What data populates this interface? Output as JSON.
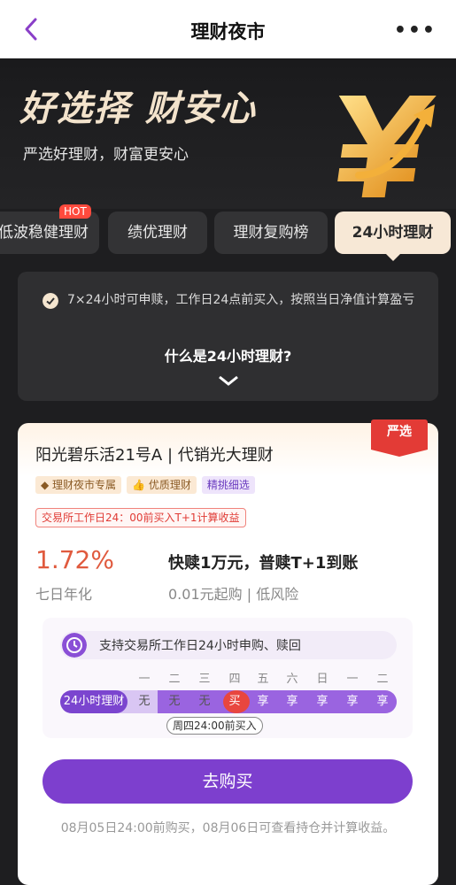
{
  "nav": {
    "title": "理财夜市",
    "more": "•••"
  },
  "hero": {
    "title": "好选择 财安心",
    "subtitle": "严选好理财，财富更安心"
  },
  "tabs": [
    {
      "label": "低波稳健理财",
      "badge": "HOT"
    },
    {
      "label": "绩优理财"
    },
    {
      "label": "理财复购榜"
    },
    {
      "label": "24小时理财",
      "active": true
    }
  ],
  "info": {
    "text": "7×24小时可申赎，工作日24点前买入，按照当日净值计算盈亏",
    "question": "什么是24小时理财?"
  },
  "product": {
    "ribbon": "严选",
    "name": "阳光碧乐活21号A | 代销光大理财",
    "tags": [
      "理财夜市专属",
      "优质理财",
      "精挑细选"
    ],
    "notice": "交易所工作日24：00前买入T+1计算收益",
    "rate": "1.72%",
    "rate_label": "七日年化",
    "feature": "快赎1万元，普赎T+1到账",
    "feature_sub": "0.01元起购 | 低风险",
    "schedule": {
      "header": "支持交易所工作日24小时申购、赎回",
      "days": [
        "一",
        "二",
        "三",
        "四",
        "五",
        "六",
        "日",
        "一",
        "二"
      ],
      "track_label": "24小时理财",
      "cells": [
        "无",
        "无",
        "无",
        "买",
        "享",
        "享",
        "享",
        "享",
        "享"
      ],
      "pointer": "周四24:00前买入"
    },
    "buy_label": "去购买",
    "footnote": "08月05日24:00前购买，08月06日可查看持仓并计算收益。"
  }
}
